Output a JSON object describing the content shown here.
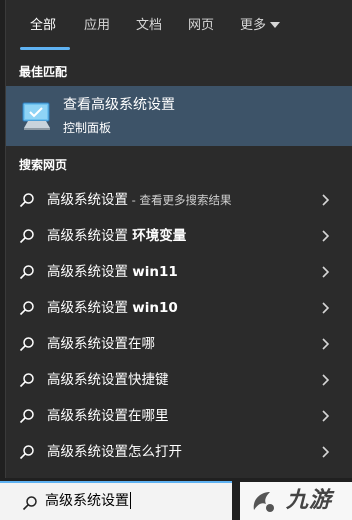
{
  "tabs": [
    {
      "label": "全部"
    },
    {
      "label": "应用"
    },
    {
      "label": "文档"
    },
    {
      "label": "网页"
    },
    {
      "label": "更多"
    }
  ],
  "best_match": {
    "header": "最佳匹配",
    "title": "查看高级系统设置",
    "subtitle": "控制面板",
    "icon": "control-panel-monitor-icon"
  },
  "web": {
    "header": "搜索网页",
    "items": [
      {
        "text": "高级系统设置",
        "suffix": " - 查看更多搜索结果",
        "bold": ""
      },
      {
        "text": "高级系统设置 ",
        "suffix": "",
        "bold": "环境变量"
      },
      {
        "text": "高级系统设置 ",
        "suffix": "",
        "bold": "win11"
      },
      {
        "text": "高级系统设置 ",
        "suffix": "",
        "bold": "win10"
      },
      {
        "text": "高级系统设置在哪",
        "suffix": "",
        "bold": ""
      },
      {
        "text": "高级系统设置快捷键",
        "suffix": "",
        "bold": ""
      },
      {
        "text": "高级系统设置在哪里",
        "suffix": "",
        "bold": ""
      },
      {
        "text": "高级系统设置怎么打开",
        "suffix": "",
        "bold": ""
      }
    ]
  },
  "search": {
    "query": "高级系统设置"
  },
  "watermark": {
    "text": "九游"
  },
  "colors": {
    "accent": "#5fb2f2",
    "best_match_bg": "#3d5368",
    "panel_bg": "#2b2b2b"
  }
}
